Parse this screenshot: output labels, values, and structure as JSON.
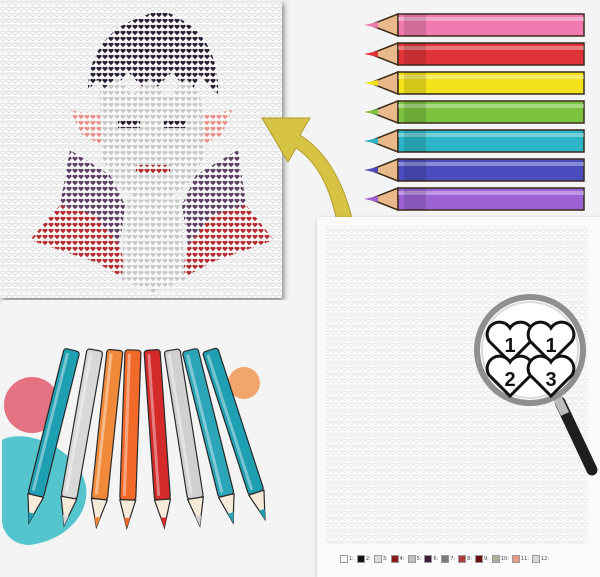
{
  "magnifier": {
    "numbers": [
      "1",
      "1",
      "2",
      "3"
    ]
  },
  "legend": {
    "items": [
      {
        "label": "1:",
        "color": "#ffffff"
      },
      {
        "label": "2:",
        "color": "#111111"
      },
      {
        "label": "3:",
        "color": "#dcdcdc"
      },
      {
        "label": "4:",
        "color": "#8b1a1a"
      },
      {
        "label": "5:",
        "color": "#c0c0c0"
      },
      {
        "label": "6:",
        "color": "#3b1d3a"
      },
      {
        "label": "7:",
        "color": "#7a7a7a"
      },
      {
        "label": "8:",
        "color": "#b03a3a"
      },
      {
        "label": "9:",
        "color": "#6b0f14"
      },
      {
        "label": "10:",
        "color": "#a9b3a0"
      },
      {
        "label": "11:",
        "color": "#e89a84"
      },
      {
        "label": "12:",
        "color": "#d9d9d9"
      }
    ]
  },
  "colors": {
    "pencils_right": [
      "#f07ab0",
      "#e0343a",
      "#f2e21a",
      "#7cc23f",
      "#2bb5c6",
      "#4b4dbf",
      "#9c62d3"
    ],
    "pencils_left": [
      "#1e9fb2",
      "#d8d8d8",
      "#f08a3a",
      "#f26a2a",
      "#d42a2a",
      "#d0d0d0",
      "#2aa6b8",
      "#1e9fb2"
    ],
    "arrow": "#d6c243"
  }
}
